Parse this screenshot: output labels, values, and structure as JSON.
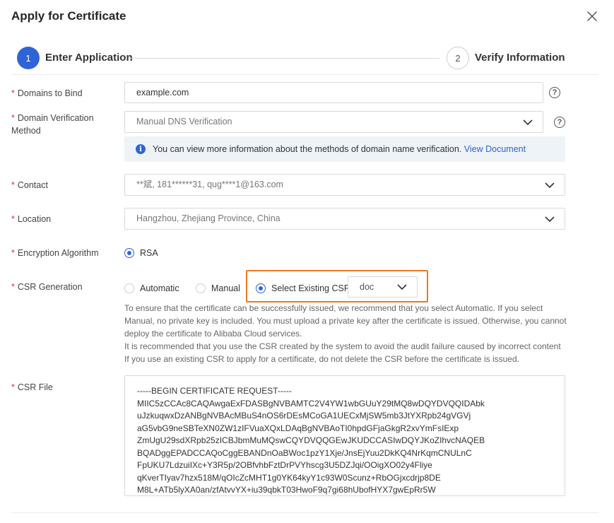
{
  "dialog": {
    "title": "Apply for Certificate",
    "close_icon": "close-icon"
  },
  "steps": [
    {
      "number": "1",
      "label": "Enter Application",
      "active": true
    },
    {
      "number": "2",
      "label": "Verify Information",
      "active": false
    }
  ],
  "form": {
    "domains": {
      "label": "Domains to Bind",
      "value": "example.com"
    },
    "verification": {
      "label_line1": "Domain Verification",
      "label_line2": "Method",
      "value": "Manual DNS Verification",
      "info_text": "You can view more information about the methods of domain name verification.",
      "info_link": "View Document"
    },
    "contact": {
      "label": "Contact",
      "value": "**斌, 181******31, qug****1@163.com"
    },
    "location": {
      "label": "Location",
      "value": "Hangzhou, Zhejiang Province, China"
    },
    "encryption": {
      "label": "Encryption Algorithm",
      "option": "RSA"
    },
    "csr_generation": {
      "label": "CSR Generation",
      "options": [
        "Automatic",
        "Manual",
        "Select Existing CSR"
      ],
      "selected": "Select Existing CSR",
      "existing_csr_value": "doc",
      "description": [
        "To ensure that the certificate can be successfully issued, we recommend that you select Automatic. If you select",
        "Manual, no private key is included. You must upload a private key after the certificate is issued. Otherwise, you cannot",
        "deploy the certificate to Alibaba Cloud services.",
        "It is recommended that you use the CSR created by the system to avoid the audit failure caused by incorrect content",
        "If you use an existing CSR to apply for a certificate, do not delete the CSR before the certificate is issued."
      ]
    },
    "csr_file": {
      "label": "CSR File",
      "lines": [
        "-----BEGIN CERTIFICATE REQUEST-----",
        "MIIC5zCCAc8CAQAwgaExFDASBgNVBAMTC2V4YW1wbGUuY29tMQ8wDQYDVQQIDAbk",
        "uJzkuqwxDzANBgNVBAcMBuS4nOS6rDEsMCoGA1UECxMjSW5mb3JtYXRpb24gVGVj",
        "aG5vbG9neSBTeXN0ZW1zIFVuaXQxLDAqBgNVBAoTI0hpdGFjaGkgR2xvYmFsIExp",
        "ZmUgU29sdXRpb25zICBJbmMuMQswCQYDVQQGEwJKUDCCASIwDQYJKoZIhvcNAQEB",
        "BQADggEPADCCAQoCggEBANDnOaBWoc1pzY1Xje/JnsEjYuu2DkKQ4NrKqmCNULnC",
        "FpUKU7LdzuiIXc+Y3R5p/2OBfvhbFztDrPVYhscg3U5DZJqi/OOigXO02y4Fliye",
        "qKverTIyav7hzx518M/qOIcZcMHT1g0YK64kyY1c93W0Scunz+RbOGjxcdrjp8DE",
        "M8L+ATb5lyXA0an/zfAtvvYX+iu39qbkT03HwoF9q7gi68hUbofHYX7gwEpRr5W"
      ]
    }
  },
  "colors": {
    "primary": "#2f64d6",
    "highlight": "#ec7a1c",
    "required": "#d9363e"
  }
}
